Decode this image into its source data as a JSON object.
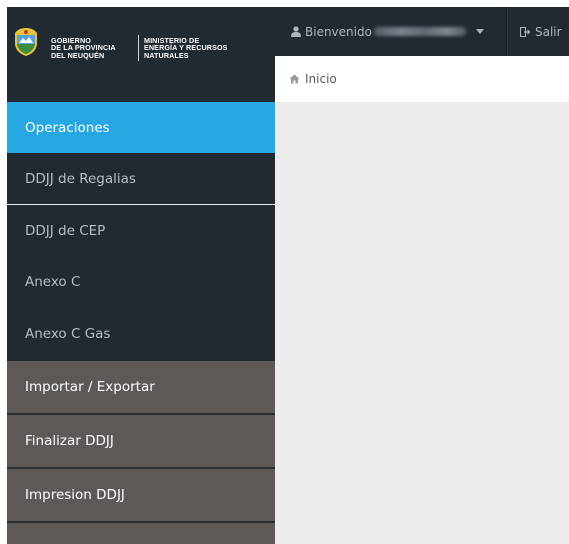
{
  "brand": {
    "line_1": [
      "GOBIERNO",
      "DE LA PROVINCIA",
      "DEL NEUQUÉN"
    ],
    "line_2": [
      "MINISTERIO DE",
      "ENERGÍA Y RECURSOS",
      "NATURALES"
    ]
  },
  "navbar": {
    "welcome_label": "Bienvenido",
    "logout_label": "Salir",
    "user_icon": "user-icon",
    "logout_icon": "sign-out-icon"
  },
  "breadcrumb": {
    "home_icon": "home-icon",
    "label": "Inicio"
  },
  "sidebar": {
    "items": [
      {
        "label": "Operaciones",
        "state": "active"
      },
      {
        "label": "DDJJ de Regalias",
        "state": "normal"
      },
      {
        "label": "DDJJ de CEP",
        "state": "normal"
      },
      {
        "label": "Anexo C",
        "state": "normal"
      },
      {
        "label": "Anexo C Gas",
        "state": "normal"
      },
      {
        "label": "Importar / Exportar",
        "state": "group"
      },
      {
        "label": "Finalizar DDJJ",
        "state": "group"
      },
      {
        "label": "Impresion DDJJ",
        "state": "group"
      }
    ]
  },
  "colors": {
    "navbar_bg": "#222a31",
    "active_bg": "#27a7e1",
    "group_bg": "#5e5956",
    "content_bg": "#ececec"
  }
}
